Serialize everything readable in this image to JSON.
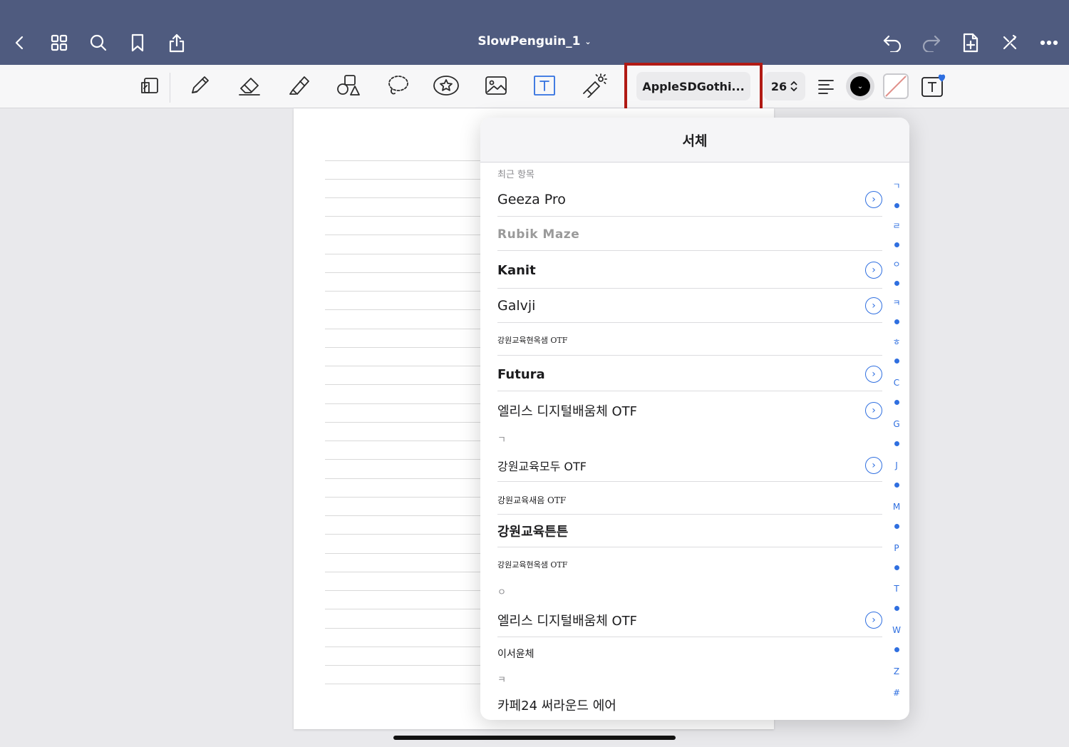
{
  "navbar": {
    "title": "SlowPenguin_1",
    "title_chevron": "⌄",
    "left_icons": [
      "back-icon",
      "grid-icon",
      "search-icon",
      "bookmark-icon",
      "share-icon"
    ],
    "right_icons": [
      "undo-icon",
      "redo-icon",
      "add-page-icon",
      "close-toolbar-icon",
      "more-icon"
    ]
  },
  "toolbar": {
    "font_name": "AppleSDGothi...",
    "font_size": "26",
    "text_color": "#000000",
    "color_dot_glyph": "⌄",
    "text_icon_glyph": "T"
  },
  "font_panel": {
    "title": "서체",
    "recent_label": "최근 항목",
    "recent": [
      {
        "name": "Geeza Pro",
        "info": "›"
      },
      {
        "name": "Rubik Maze",
        "info": ""
      },
      {
        "name": "Kanit",
        "info": "›"
      },
      {
        "name": "Galvji",
        "info": "›"
      },
      {
        "name": "강원교육현옥샘 OTF",
        "info": ""
      },
      {
        "name": "Futura",
        "info": "›"
      },
      {
        "name": "엘리스 디지털배움체 OTF",
        "info": "›"
      }
    ],
    "section_g": "ㄱ",
    "section_g_items": [
      {
        "name": "강원교육모두 OTF",
        "info": "›"
      },
      {
        "name": "강원교육새음 OTF",
        "info": ""
      },
      {
        "name": "강원교육튼튼",
        "info": ""
      },
      {
        "name": "강원교육현옥샘 OTF",
        "info": ""
      }
    ],
    "section_o": "ㅇ",
    "section_o_items": [
      {
        "name": "엘리스 디지털배움체 OTF",
        "info": "›"
      },
      {
        "name": "이서윤체",
        "info": ""
      }
    ],
    "section_k": "ㅋ",
    "section_k_items": [
      {
        "name": "카페24 써라운드 에어",
        "info": ""
      }
    ],
    "index": [
      "ㄱ",
      "ㄹ",
      "ㅇ",
      "ㅋ",
      "ㅎ",
      "C",
      "G",
      "J",
      "M",
      "P",
      "T",
      "W",
      "Z",
      "#"
    ]
  },
  "colors": {
    "navbar": "#4f5b7f",
    "accent": "#2f6fe0",
    "highlight_box": "#b11a14"
  }
}
